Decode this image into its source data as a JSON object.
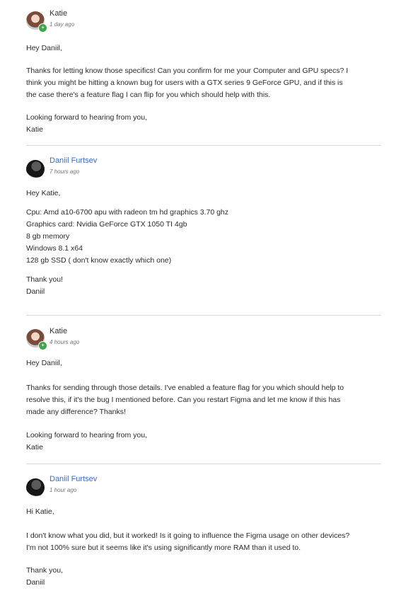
{
  "posts": [
    {
      "author": "Katie",
      "time": "1 day ago",
      "avatar_icon": "user-avatar-katie",
      "badge_glyph": "+",
      "body": [
        "Hey Daniil,",
        "Thanks for letting know those specifics! Can you confirm for me your Computer and GPU specs? I\nthink you might be hitting a known bug for users with a GTX series 9 GeForce GPU, and if this is\nthe case there's a feature flag I can flip for you which should help with this.",
        "Looking forward to hearing from you,\nKatie"
      ]
    },
    {
      "author": "Daniil Furtsev",
      "time": "7 hours ago",
      "avatar_icon": "user-avatar-daniil",
      "body": [
        "Hey Katie,",
        "Cpu: Amd a10-6700 apu with radeon tm hd graphics 3.70 ghz\nGraphics card: Nvidia GeForce GTX 1050 TI 4gb\n8 gb memory\nWindows 8.1 x64\n128 gb SSD ( don't know exactly which one)",
        "Thank you!\nDaniil"
      ]
    },
    {
      "author": "Katie",
      "time": "4 hours ago",
      "avatar_icon": "user-avatar-katie",
      "badge_glyph": "+",
      "body": [
        "Hey Daniil,",
        "Thanks for sending through those details. I've enabled a feature flag for you which should help to\nresolve this, if it's the bug I mentioned before. Can you restart Figma and let me know if this has\nmade any difference? Thanks!",
        "Looking forward to hearing from you,\nKatie"
      ]
    },
    {
      "author": "Daniil Furtsev",
      "time": "1 hour ago",
      "avatar_icon": "user-avatar-daniil",
      "body": [
        "Hi Katie,",
        "I don't know what you did, but it worked! Is it going to influence the Figma usage on other devices?\nI'm not 100% sure but it seems like it's using significantly more RAM than it used to.",
        "Thank you,\nDaniil"
      ]
    }
  ]
}
